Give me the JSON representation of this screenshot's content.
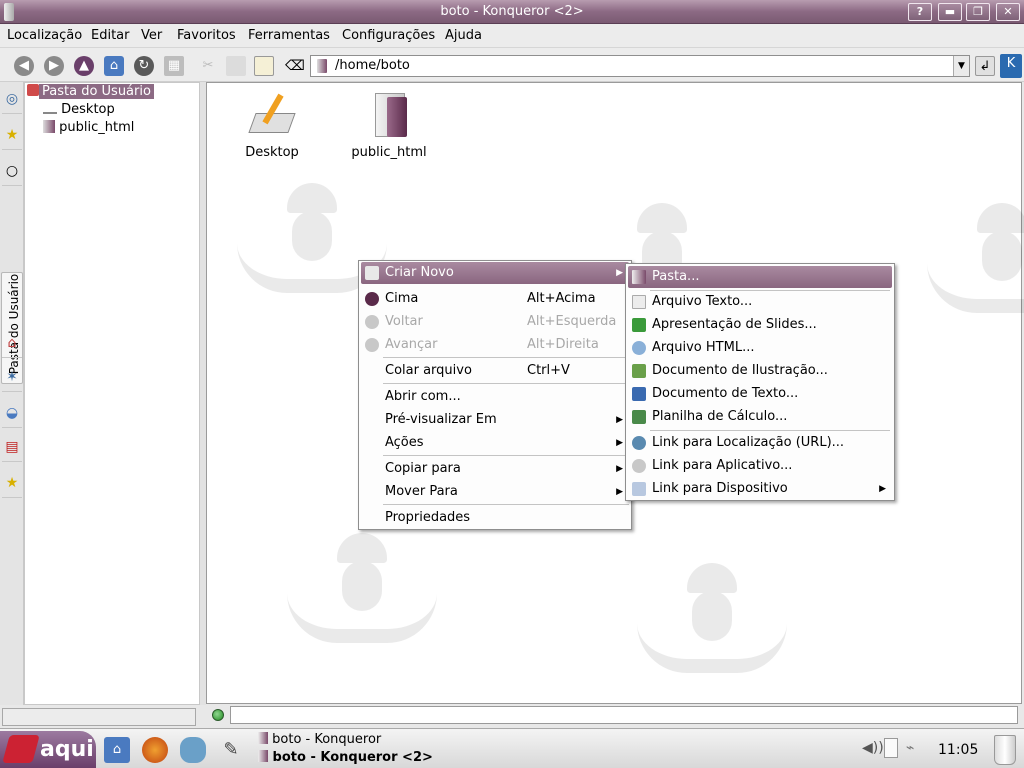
{
  "window": {
    "title": "boto - Konqueror <2>",
    "buttons": {
      "help": "?",
      "minimize": "▬",
      "maximize": "❐",
      "close": "✕"
    }
  },
  "menubar": [
    "Localização",
    "Editar",
    "Ver",
    "Favoritos",
    "Ferramentas",
    "Configurações",
    "Ajuda"
  ],
  "location": {
    "value": "/home/boto"
  },
  "sidebar": {
    "tab_label": "Pasta do Usuário",
    "tree": {
      "root": "Pasta do Usuário",
      "children": [
        "Desktop",
        "public_html"
      ]
    }
  },
  "files": [
    {
      "name": "Desktop",
      "icon": "desktop-folder-icon"
    },
    {
      "name": "public_html",
      "icon": "folder-icon"
    }
  ],
  "context_menu": {
    "items": [
      {
        "label": "Criar Novo",
        "submenu": true,
        "highlighted": true
      },
      {
        "label": "Cima",
        "shortcut": "Alt+Acima"
      },
      {
        "label": "Voltar",
        "shortcut": "Alt+Esquerda",
        "disabled": true
      },
      {
        "label": "Avançar",
        "shortcut": "Alt+Direita",
        "disabled": true
      },
      {
        "label": "Colar arquivo",
        "shortcut": "Ctrl+V"
      },
      {
        "label": "Abrir com..."
      },
      {
        "label": "Pré-visualizar Em",
        "submenu": true
      },
      {
        "label": "Ações",
        "submenu": true
      },
      {
        "label": "Copiar para",
        "submenu": true
      },
      {
        "label": "Mover Para",
        "submenu": true
      },
      {
        "label": "Propriedades"
      }
    ]
  },
  "submenu": {
    "items": [
      {
        "label": "Pasta...",
        "highlighted": true
      },
      {
        "label": "Arquivo Texto..."
      },
      {
        "label": "Apresentação de Slides..."
      },
      {
        "label": "Arquivo HTML..."
      },
      {
        "label": "Documento de Ilustração..."
      },
      {
        "label": "Documento de Texto..."
      },
      {
        "label": "Planilha de Cálculo..."
      },
      {
        "label": "Link para Localização (URL)..."
      },
      {
        "label": "Link para Aplicativo..."
      },
      {
        "label": "Link para Dispositivo",
        "submenu": true
      }
    ]
  },
  "taskbar": {
    "start_label": "aqui",
    "tasks": [
      "boto - Konqueror",
      "boto - Konqueror <2>"
    ],
    "clock": "11:05"
  },
  "colors": {
    "accent": "#8c6a84",
    "titlebar": "#8c6a84"
  }
}
